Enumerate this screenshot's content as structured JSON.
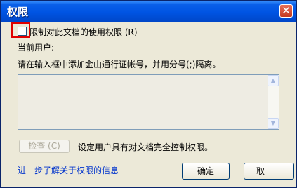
{
  "window": {
    "title": "权限",
    "close_glyph": "✕"
  },
  "restrict": {
    "checked": false,
    "label": "限制对此文档的使用权限 (R)"
  },
  "current_user_label": "当前用户:",
  "instruction": "请在输入框中添加金山通行证帐号，并用分号(;)隔离。",
  "users_list": {
    "value": "",
    "scroll_up_icon": "triangle-up",
    "scroll_down_icon": "triangle-down"
  },
  "check_button": "检查 (C)",
  "full_control_text": "设定用户具有对文档完全控制权限。",
  "help_link": "进一步了解关于权限的信息",
  "ok_button": "确定",
  "cancel_button": "取"
}
